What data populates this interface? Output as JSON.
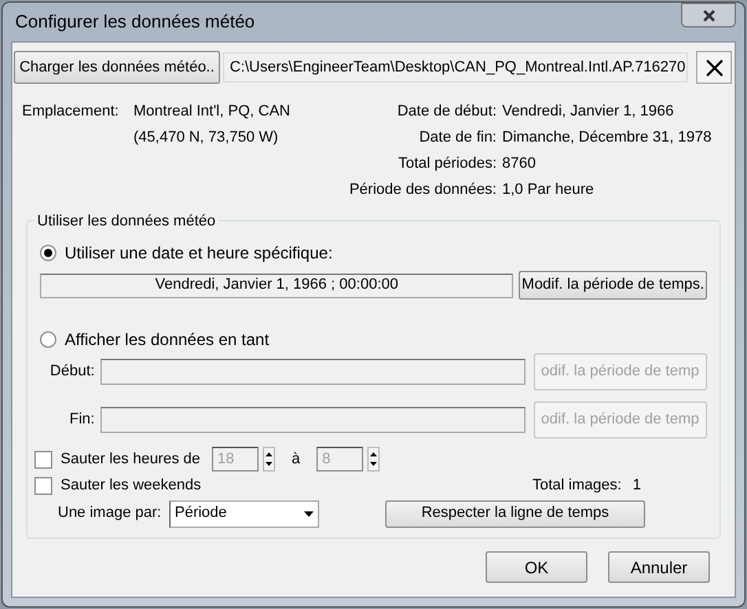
{
  "window": {
    "title": "Configurer les données météo"
  },
  "file": {
    "load_button": "Charger les données météo..",
    "path": "C:\\Users\\EngineerTeam\\Desktop\\CAN_PQ_Montreal.Intl.AP.716270"
  },
  "info_left": [
    {
      "label": "Emplacement:",
      "value": "Montreal Int'l, PQ, CAN"
    },
    {
      "value": "(45,470 N, 73,750 W)"
    }
  ],
  "info_right": [
    {
      "label": "Date de début:",
      "value": "Vendredi, Janvier 1, 1966"
    },
    {
      "label": "Date de fin:",
      "value": "Dimanche, Décembre 31, 1978"
    },
    {
      "label": "Total périodes:",
      "value": "8760"
    },
    {
      "label": "Période des données:",
      "value": "1,0 Par heure"
    }
  ],
  "group": {
    "title": "Utiliser les données météo",
    "options": [
      {
        "label": "Utiliser une date et heure spécifique:",
        "selected": true
      },
      {
        "label": "Afficher les données en tant",
        "selected": false
      }
    ],
    "specific": {
      "value": "Vendredi, Janvier 1, 1966 ; 00:00:00",
      "button": "Modif. la période de temps."
    },
    "range": [
      {
        "label": "Début:",
        "button": "odif. la période de temp",
        "disabled": true
      },
      {
        "label": "Fin:",
        "button": "odif. la période de temp",
        "disabled": true
      }
    ],
    "skip_hours": {
      "label": "Sauter les heures de",
      "checked": false,
      "from": "18",
      "to_label": "à",
      "to": "8",
      "disabled": true
    },
    "skip_weekends": {
      "label": "Sauter les weekends",
      "checked": false
    },
    "total_images": {
      "label": "Total images:",
      "value": "1"
    },
    "image_per": {
      "label": "Une image par:",
      "value": "Période"
    },
    "timeline_button": "Respecter la ligne de temps"
  },
  "buttons": [
    "OK",
    "Annuler"
  ]
}
